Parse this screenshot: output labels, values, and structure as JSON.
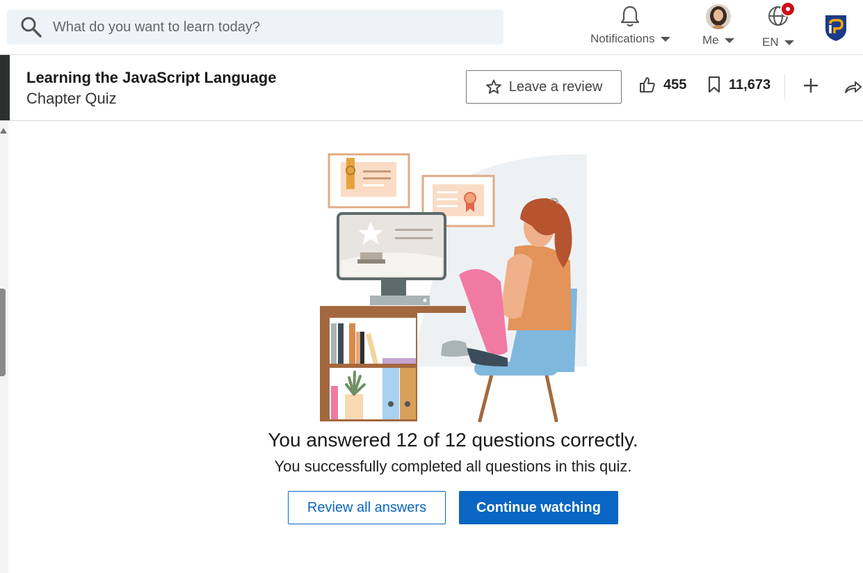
{
  "search": {
    "placeholder": "What do you want to learn today?"
  },
  "nav": {
    "notifications_label": "Notifications",
    "me_label": "Me",
    "language_label": "EN"
  },
  "course": {
    "title": "Learning the JavaScript Language",
    "subtitle": "Chapter Quiz",
    "review_label": "Leave a review",
    "likes": "455",
    "saves": "11,673"
  },
  "quiz": {
    "result_title": "You answered 12 of 12 questions correctly.",
    "result_subtitle": "You successfully completed all questions in this quiz.",
    "review_button": "Review all answers",
    "continue_button": "Continue watching"
  },
  "colors": {
    "accent": "#0a66c2",
    "badge": "#cc1016"
  },
  "icons": [
    "search-icon",
    "bell-icon",
    "avatar",
    "globe-icon",
    "logo-icon",
    "star-icon",
    "thumbs-up-icon",
    "bookmark-icon",
    "plus-icon",
    "share-icon"
  ]
}
